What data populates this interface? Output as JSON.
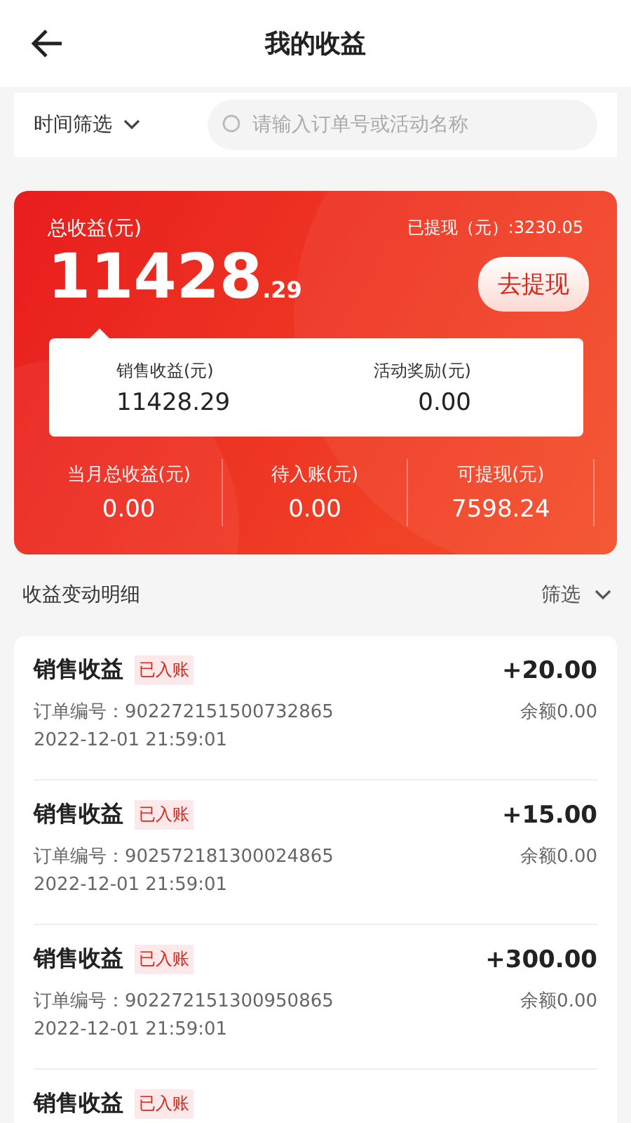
{
  "header": {
    "title": "我的收益"
  },
  "filter": {
    "label": "时间筛选",
    "search_placeholder": "请输入订单号或活动名称"
  },
  "summary": {
    "total_label": "总收益(元)",
    "total_int": "11428",
    "total_dec": ".29",
    "withdrawn": "已提现（元）:3230.05",
    "withdraw_button": "去提现",
    "breakdown": [
      {
        "label": "销售收益(元)",
        "value": "11428.29"
      },
      {
        "label": "活动奖励(元)",
        "value": "0.00"
      }
    ],
    "stats": [
      {
        "label": "当月总收益(元)",
        "value": "0.00"
      },
      {
        "label": "待入账(元)",
        "value": "0.00"
      },
      {
        "label": "可提现(元)",
        "value": "7598.24"
      }
    ]
  },
  "details": {
    "title": "收益变动明细",
    "filter_label": "筛选",
    "items": [
      {
        "title": "销售收益",
        "tag": "已入账",
        "amount": "+20.00",
        "order": "订单编号：902272151500732865",
        "balance": "余额0.00",
        "time": "2022-12-01 21:59:01"
      },
      {
        "title": "销售收益",
        "tag": "已入账",
        "amount": "+15.00",
        "order": "订单编号：902572181300024865",
        "balance": "余额0.00",
        "time": "2022-12-01 21:59:01"
      },
      {
        "title": "销售收益",
        "tag": "已入账",
        "amount": "+300.00",
        "order": "订单编号：902272151300950865",
        "balance": "余额0.00",
        "time": "2022-12-01 21:59:01"
      },
      {
        "title": "销售收益",
        "tag": "已入账"
      }
    ]
  }
}
